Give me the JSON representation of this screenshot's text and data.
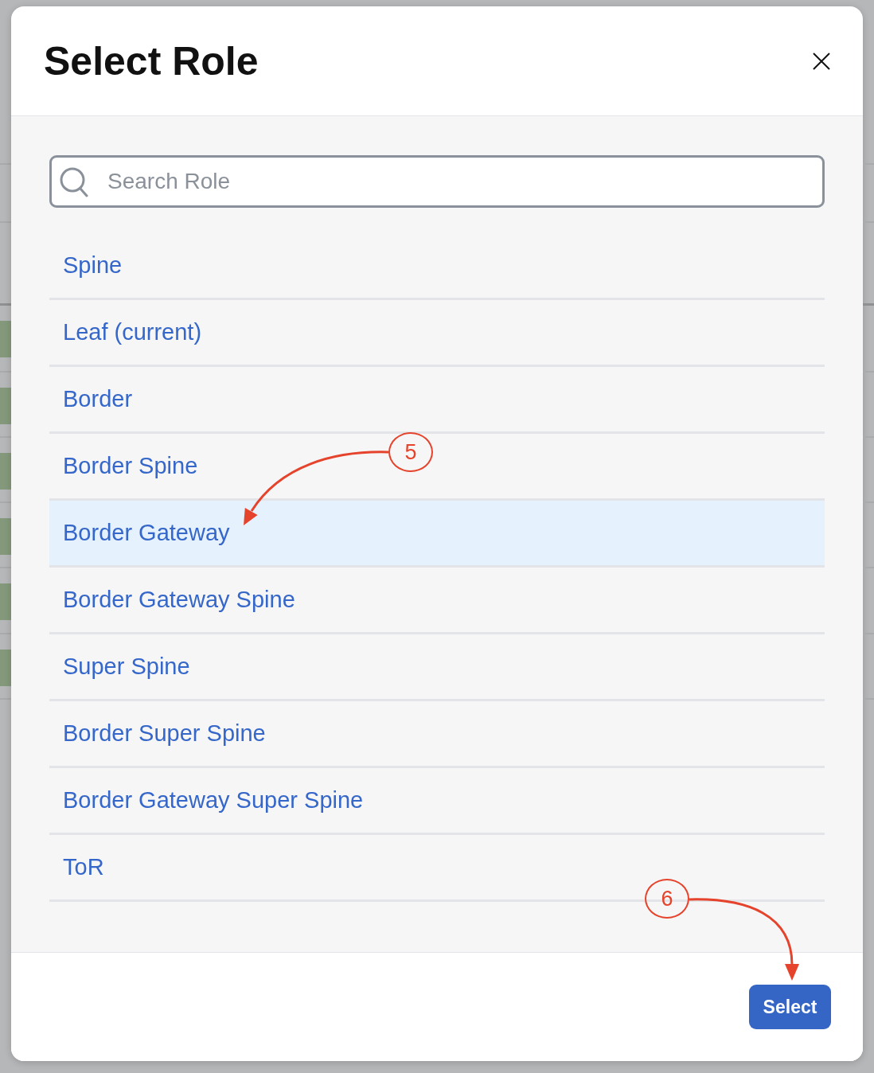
{
  "dialog": {
    "title": "Select Role"
  },
  "search": {
    "placeholder": "Search Role"
  },
  "roles": [
    {
      "label": "Spine",
      "selected": false
    },
    {
      "label": "Leaf (current)",
      "selected": false
    },
    {
      "label": "Border",
      "selected": false
    },
    {
      "label": "Border Spine",
      "selected": false
    },
    {
      "label": "Border Gateway",
      "selected": true
    },
    {
      "label": "Border Gateway Spine",
      "selected": false
    },
    {
      "label": "Super Spine",
      "selected": false
    },
    {
      "label": "Border Super Spine",
      "selected": false
    },
    {
      "label": "Border Gateway Super Spine",
      "selected": false
    },
    {
      "label": "ToR",
      "selected": false
    }
  ],
  "footer": {
    "primary_button": {
      "label": "Select"
    }
  },
  "annotations": [
    {
      "label": "5"
    },
    {
      "label": "6"
    }
  ]
}
